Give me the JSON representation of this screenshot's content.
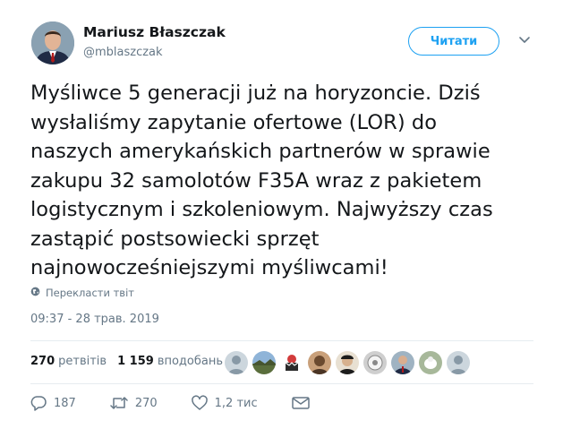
{
  "author": {
    "name": "Mariusz Błaszczak",
    "handle": "@mblaszczak"
  },
  "follow_button": "Читати",
  "tweet": {
    "lines": [
      "Myśliwce 5 generacji już na horyzoncie. Dziś",
      "wysłaliśmy zapytanie ofertowe (LOR) do",
      "naszych amerykańskich partnerów w sprawie",
      "zakupu 32 samolotów F35A wraz z pakietem",
      "logistycznym i szkoleniowym. Najwyższy czas",
      "zastąpić postsowiecki sprzęt",
      "najnowocześniejszymi myśliwcami!"
    ],
    "translate_label": "Перекласти твіт",
    "timestamp": "09:37 - 28 трав. 2019"
  },
  "stats": {
    "retweets_count": "270",
    "retweets_label": "ретвітів",
    "likes_count": "1 159",
    "likes_label": "вподобань"
  },
  "actions": {
    "replies": "187",
    "retweets": "270",
    "likes": "1,2 тис"
  },
  "colors": {
    "accent": "#1da1f2",
    "secondary_text": "#657786",
    "divider": "#e6ecf0"
  }
}
